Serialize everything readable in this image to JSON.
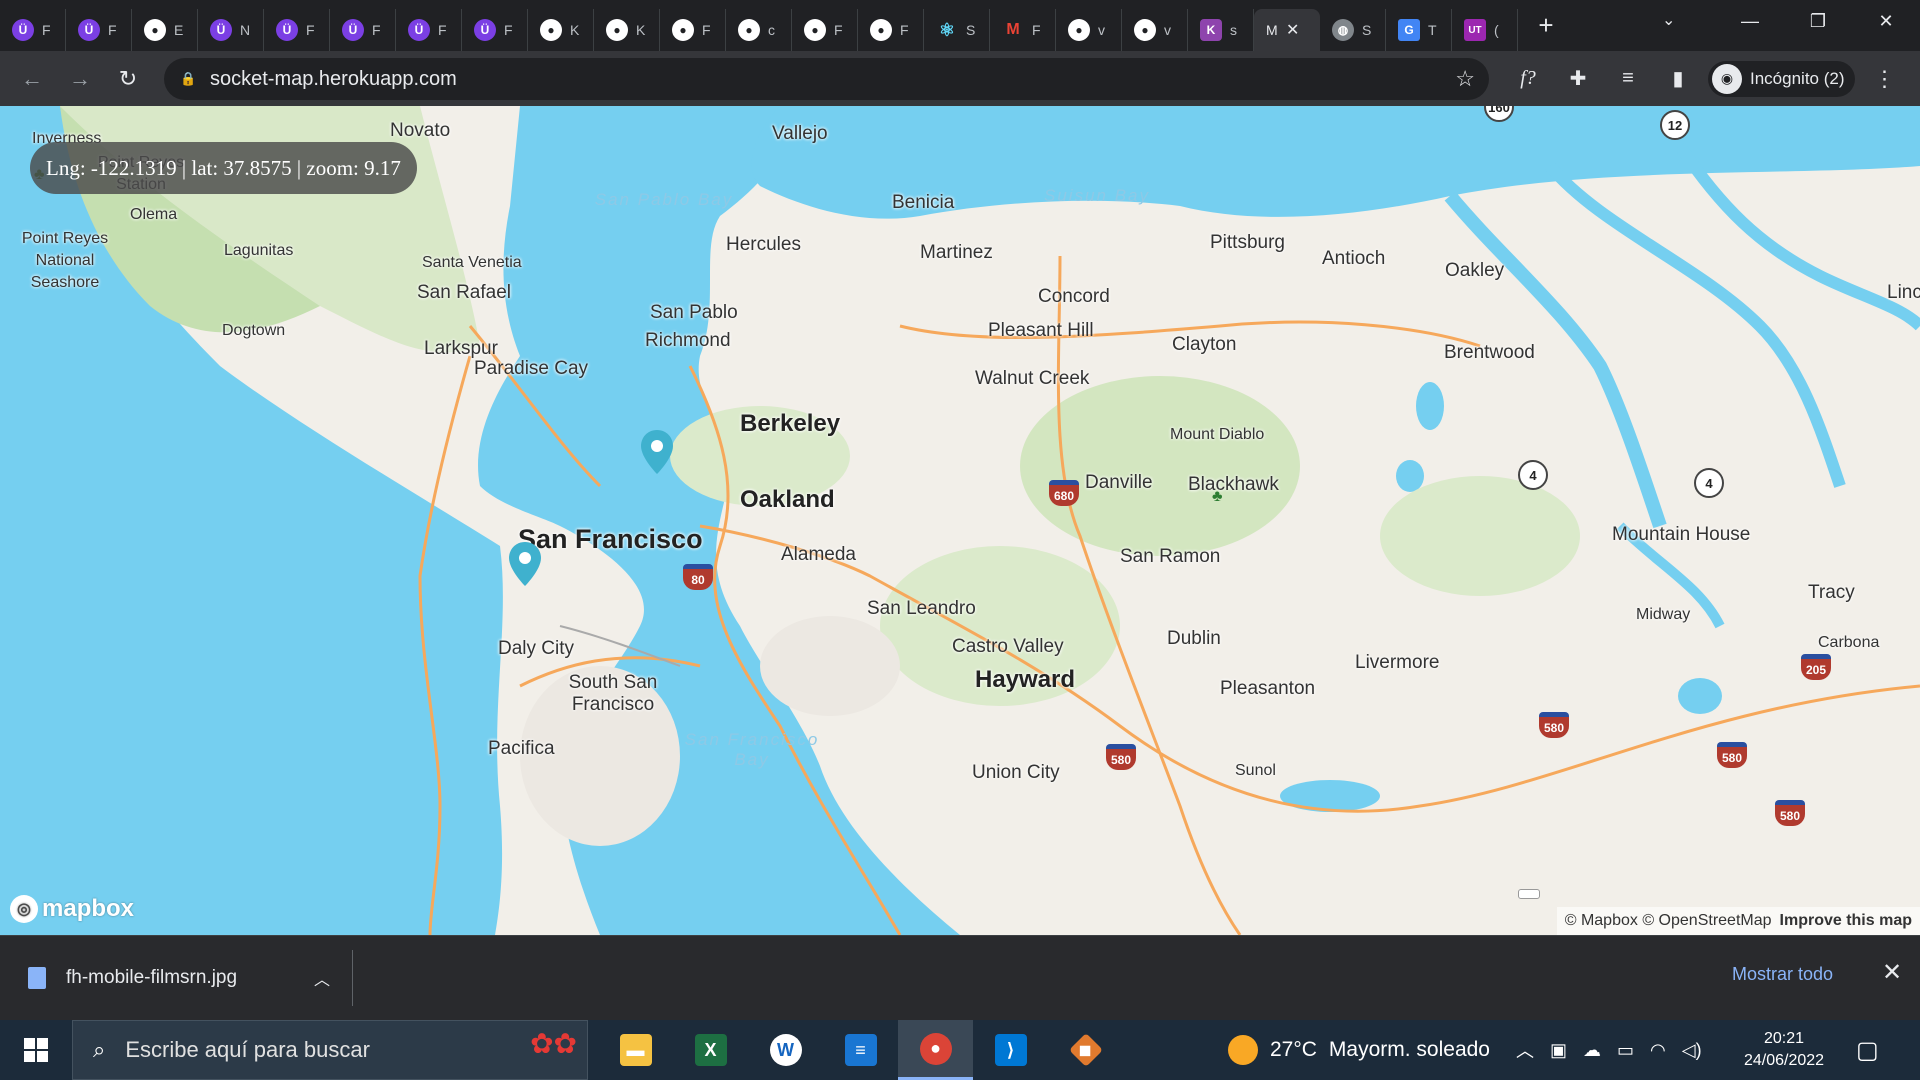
{
  "browser": {
    "tabs": [
      {
        "icon": "udemy-icon",
        "title": "F",
        "class": "u"
      },
      {
        "icon": "udemy-icon",
        "title": "F",
        "class": "u"
      },
      {
        "icon": "github-icon",
        "title": "E",
        "class": "gh"
      },
      {
        "icon": "udemy-icon",
        "title": "N",
        "class": "u"
      },
      {
        "icon": "udemy-icon",
        "title": "F",
        "class": "u"
      },
      {
        "icon": "udemy-icon",
        "title": "F",
        "class": "u"
      },
      {
        "icon": "udemy-icon",
        "title": "F",
        "class": "u"
      },
      {
        "icon": "udemy-icon",
        "title": "F",
        "class": "u"
      },
      {
        "icon": "github-icon",
        "title": "K",
        "class": "gh"
      },
      {
        "icon": "github-icon",
        "title": "K",
        "class": "gh"
      },
      {
        "icon": "github-icon",
        "title": "F",
        "class": "gh"
      },
      {
        "icon": "github-icon",
        "title": "c",
        "class": "gh"
      },
      {
        "icon": "github-icon",
        "title": "F",
        "class": "gh"
      },
      {
        "icon": "github-icon",
        "title": "F",
        "class": "gh"
      },
      {
        "icon": "react-icon",
        "title": "S",
        "class": "react"
      },
      {
        "icon": "gmail-icon",
        "title": "F",
        "class": "gm"
      },
      {
        "icon": "github-icon",
        "title": "v",
        "class": "gh"
      },
      {
        "icon": "github-icon",
        "title": "v",
        "class": "gh"
      },
      {
        "icon": "kubernetes-icon",
        "title": "s",
        "class": "k"
      },
      {
        "icon": "mapbox-icon",
        "title": "M",
        "class": "active"
      },
      {
        "icon": "globe-icon",
        "title": "S",
        "class": "globe"
      },
      {
        "icon": "google-translate-icon",
        "title": "T",
        "class": "gt"
      },
      {
        "icon": "ut-icon",
        "title": "(",
        "class": "ut"
      }
    ],
    "url": "socket-map.herokuapp.com",
    "profile_label": "Incógnito (2)"
  },
  "map": {
    "coord_text": "Lng: -122.1319 | lat: 37.8575 | zoom: 9.17",
    "places": [
      {
        "name": "Novato",
        "cls": ""
      },
      {
        "name": "Vallejo",
        "cls": ""
      },
      {
        "name": "Inverness",
        "cls": "sm"
      },
      {
        "name": "Point Reyes Station",
        "cls": "sm"
      },
      {
        "name": "Point Reyes National Seashore",
        "cls": "sm"
      },
      {
        "name": "Olema",
        "cls": "sm"
      },
      {
        "name": "Benicia",
        "cls": ""
      },
      {
        "name": "Hercules",
        "cls": ""
      },
      {
        "name": "Martinez",
        "cls": ""
      },
      {
        "name": "Pittsburg",
        "cls": ""
      },
      {
        "name": "Antioch",
        "cls": ""
      },
      {
        "name": "Oakley",
        "cls": ""
      },
      {
        "name": "Lagunitas",
        "cls": "sm"
      },
      {
        "name": "Santa Venetia",
        "cls": "sm"
      },
      {
        "name": "San Rafael",
        "cls": ""
      },
      {
        "name": "San Pablo",
        "cls": ""
      },
      {
        "name": "Concord",
        "cls": ""
      },
      {
        "name": "Richmond",
        "cls": ""
      },
      {
        "name": "Pleasant Hill",
        "cls": ""
      },
      {
        "name": "Clayton",
        "cls": ""
      },
      {
        "name": "Brentwood",
        "cls": ""
      },
      {
        "name": "Dogtown",
        "cls": "sm"
      },
      {
        "name": "Larkspur",
        "cls": ""
      },
      {
        "name": "Paradise Cay",
        "cls": ""
      },
      {
        "name": "Walnut Creek",
        "cls": ""
      },
      {
        "name": "Berkeley",
        "cls": "lg"
      },
      {
        "name": "Mount Diablo",
        "cls": "sm"
      },
      {
        "name": "Oakland",
        "cls": "lg"
      },
      {
        "name": "Danville",
        "cls": ""
      },
      {
        "name": "Blackhawk",
        "cls": ""
      },
      {
        "name": "San Francisco",
        "cls": "xl"
      },
      {
        "name": "Alameda",
        "cls": ""
      },
      {
        "name": "San Ramon",
        "cls": ""
      },
      {
        "name": "Mountain House",
        "cls": ""
      },
      {
        "name": "Tracy",
        "cls": ""
      },
      {
        "name": "San Leandro",
        "cls": ""
      },
      {
        "name": "Midway",
        "cls": "sm"
      },
      {
        "name": "Castro Valley",
        "cls": ""
      },
      {
        "name": "Dublin",
        "cls": ""
      },
      {
        "name": "Carbona",
        "cls": "sm"
      },
      {
        "name": "Daly City",
        "cls": ""
      },
      {
        "name": "Livermore",
        "cls": ""
      },
      {
        "name": "Hayward",
        "cls": "lg"
      },
      {
        "name": "South San Francisco",
        "cls": ""
      },
      {
        "name": "Pleasanton",
        "cls": ""
      },
      {
        "name": "Pacifica",
        "cls": ""
      },
      {
        "name": "Union City",
        "cls": ""
      },
      {
        "name": "Sunol",
        "cls": "sm"
      },
      {
        "name": "Linc",
        "cls": ""
      }
    ],
    "water_labels": [
      "San Pablo Bay",
      "Suisun Bay",
      "San Francisco Bay"
    ],
    "highways": [
      "80",
      "680",
      "580",
      "580",
      "580",
      "580",
      "205"
    ],
    "routes": [
      "4",
      "4",
      "12",
      "160"
    ],
    "attribution": "© Mapbox © OpenStreetMap",
    "improve_label": "Improve this map",
    "logo_label": "mapbox"
  },
  "downloads": {
    "file_name": "fh-mobile-filmsrn.jpg",
    "show_all": "Mostrar todo"
  },
  "taskbar": {
    "search_placeholder": "Escribe aquí para buscar",
    "temperature": "27°C",
    "weather": "Mayorm. soleado",
    "time": "20:21",
    "date": "24/06/2022"
  }
}
